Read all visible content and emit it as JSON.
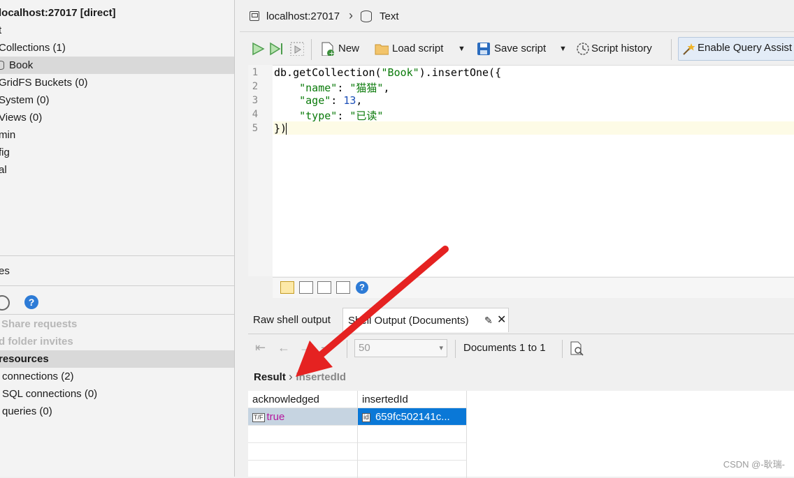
{
  "sidebar": {
    "connection_title": "localhost:27017 [direct]",
    "items": [
      "t",
      "Collections (1)",
      "Book",
      "GridFS Buckets (0)",
      "System (0)",
      "Views (0)",
      "min",
      "fig",
      "al"
    ],
    "section_label": "es",
    "share_requests": "Share requests",
    "folder_invites": "d folder invites",
    "resources_header": "resources",
    "resources": [
      "connections (2)",
      "SQL connections (0)",
      "queries (0)"
    ]
  },
  "breadcrumb": {
    "host": "localhost:27017",
    "collection": "Text"
  },
  "toolbar": {
    "new_label": "New",
    "load_script_label": "Load script",
    "save_script_label": "Save script",
    "script_history_label": "Script history",
    "assistant_label": "Enable Query Assist"
  },
  "editor": {
    "line_numbers": [
      "1",
      "2",
      "3",
      "4",
      "5"
    ],
    "lines": {
      "l1_a": "db.getCollection(",
      "l1_s": "\"Book\"",
      "l1_b": ").insertOne({",
      "l2_indent": "    ",
      "l2_k": "\"name\"",
      "l2_colon": ": ",
      "l2_v": "\"猫猫\"",
      "l2_end": ",",
      "l3_indent": "    ",
      "l3_k": "\"age\"",
      "l3_colon": ": ",
      "l3_v": "13",
      "l3_end": ",",
      "l4_indent": "    ",
      "l4_k": "\"type\"",
      "l4_colon": ": ",
      "l4_v": "\"已读\"",
      "l5": "})"
    },
    "help_glyph": "?"
  },
  "output": {
    "tab_raw": "Raw shell output",
    "tab_documents": "Shell Output (Documents)",
    "page_size": "50",
    "documents_range": "Documents 1 to 1",
    "result_crumb": "Result",
    "result_field": "insertedId",
    "columns": [
      "acknowledged",
      "insertedId"
    ],
    "rows": [
      {
        "acknowledged_tag": "T/F",
        "acknowledged": "true",
        "inserted_tag": "id",
        "insertedId": "659fc502141c..."
      }
    ]
  },
  "watermark": "CSDN @-耿瑞-",
  "colors": {
    "selection_blue": "#0a78d7",
    "arrow_red": "#e52221",
    "bool_magenta": "#b5179e"
  }
}
